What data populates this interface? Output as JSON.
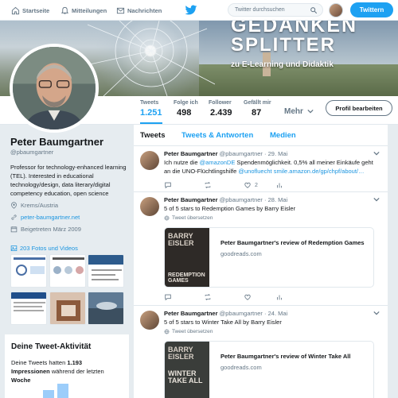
{
  "nav": {
    "home": "Startseite",
    "notifications": "Mitteilungen",
    "messages": "Nachrichten",
    "search_placeholder": "Twitter durchsuchen",
    "tweet_button": "Twittern",
    "accent": "#1da1f2"
  },
  "banner": {
    "line1": "GEDANKEN",
    "line2": "SPLITTER",
    "subtitle": "zu E-Learning und Didaktik"
  },
  "stats": [
    {
      "label": "Tweets",
      "value": "1.251"
    },
    {
      "label": "Folge ich",
      "value": "498"
    },
    {
      "label": "Follower",
      "value": "2.439"
    },
    {
      "label": "Gefällt mir",
      "value": "87"
    }
  ],
  "more_label": "Mehr",
  "edit_profile": "Profil bearbeiten",
  "profile": {
    "name": "Peter Baumgartner",
    "handle": "@pbaumgartner",
    "bio": "Professor for technology-enhanced learning (TEL). Interested in educational technology/design, data literary/digital competency education, open science",
    "location": "Krems/Austria",
    "website": "peter-baumgartner.net",
    "joined": "Beigetreten März 2009",
    "photos_link": "203 Fotos und Videos"
  },
  "activity": {
    "title": "Deine Tweet-Aktivität",
    "text_pre": "Deine Tweets hatten ",
    "count": "1.193",
    "text_bold_tail": "Impressionen",
    "text_post": " während der letzten",
    "text_last": "Woche"
  },
  "tabs": [
    "Tweets",
    "Tweets & Antworten",
    "Medien"
  ],
  "tweets": [
    {
      "name": "Peter Baumgartner",
      "handle": "@pbaumgartner",
      "date": "29. Mai",
      "text_a": "Ich nutze die ",
      "mention": "@amazonDE",
      "text_b": " Spendenmöglichkeit. 0,5% all meiner Einkäufe geht",
      "text_c": "an  die UNO-Flüchtlingshilfe ",
      "mention2": "@unofluecht",
      "link": " smile.amazon.de/gp/chpf/about/…",
      "likes": "2"
    },
    {
      "name": "Peter Baumgartner",
      "handle": "@pbaumgartner",
      "date": "28. Mai",
      "text": "5 of 5 stars to Redemption Games by Barry Eisler",
      "translate": "Tweet übersetzen",
      "card_title": "Peter Baumgartner's review of Redemption Games",
      "card_domain": "goodreads.com",
      "cover_author": "BARRY EISLER",
      "cover_title": "REDEMPTION GAMES"
    },
    {
      "name": "Peter Baumgartner",
      "handle": "@pbaumgartner",
      "date": "24. Mai",
      "text": "5 of 5 stars to Winter Take All by Barry Eisler",
      "translate": "Tweet übersetzen",
      "card_title": "Peter Baumgartner's review of Winter Take All",
      "card_domain": "goodreads.com",
      "cover_author": "BARRY EISLER",
      "cover_title": "WINTER TAKE ALL"
    }
  ]
}
